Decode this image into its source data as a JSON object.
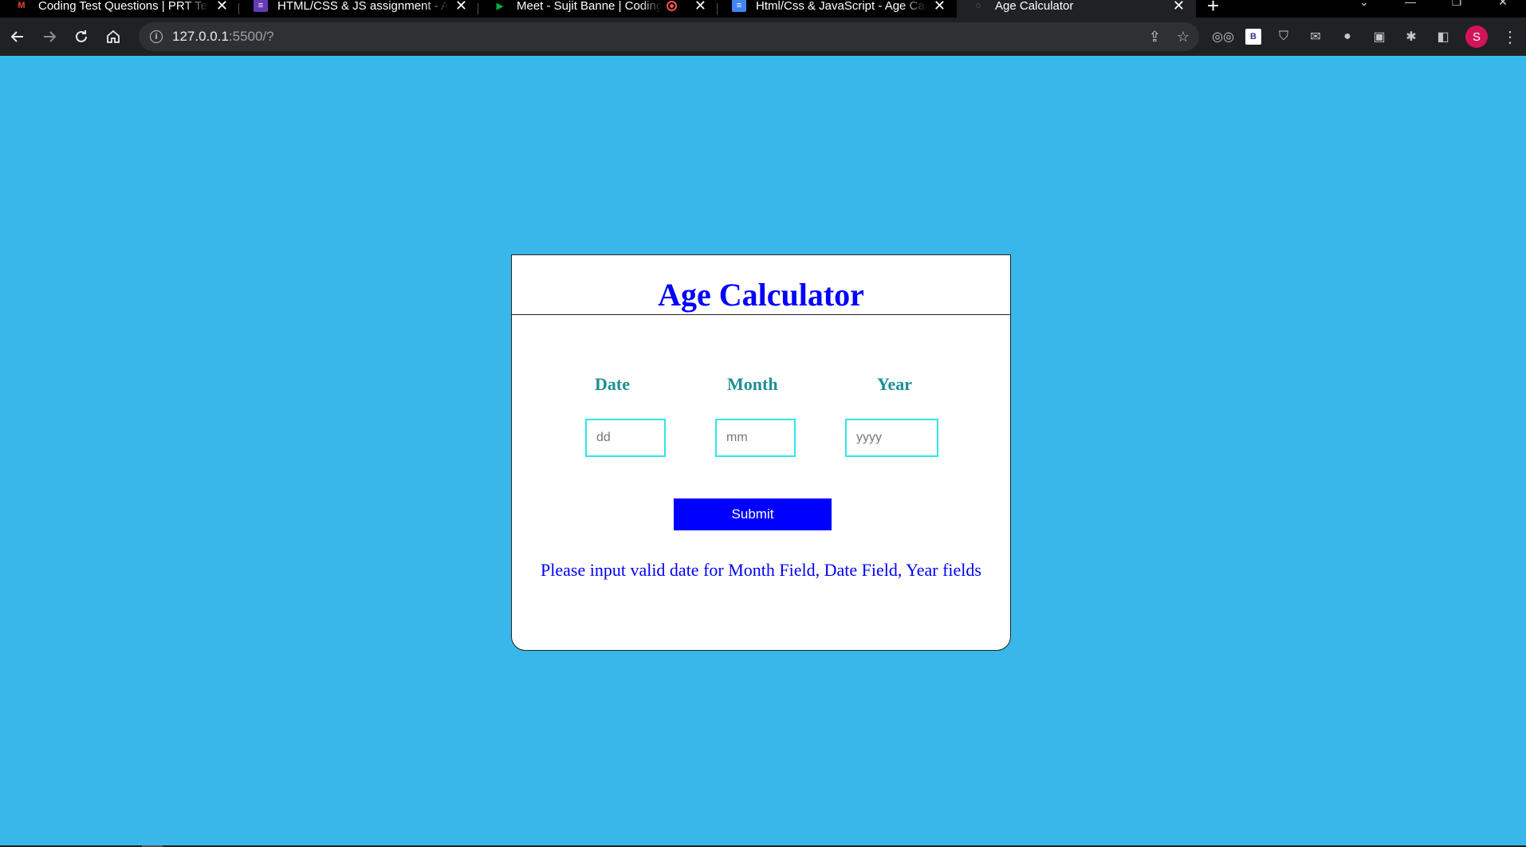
{
  "browser": {
    "tabs": [
      {
        "title": "Coding Test Questions | PRT Test",
        "favicon": "M",
        "favicon_color": "#ea4335"
      },
      {
        "title": "HTML/CSS & JS assignment - Age Calculator",
        "favicon": "≡",
        "favicon_color": "#673ab7"
      },
      {
        "title": "Meet - Sujit Banne | Coding",
        "favicon": "▶",
        "favicon_color": "#00ac47"
      },
      {
        "title": "Html/Css & JavaScript - Age Calculator",
        "favicon": "≡",
        "favicon_color": "#4285f4"
      },
      {
        "title": "Age Calculator",
        "favicon": "◌",
        "favicon_color": "#9aa0a6"
      }
    ],
    "close_glyph": "✕",
    "new_tab_glyph": "+",
    "url_host": "127.0.0.1",
    "url_path": ":5500/?",
    "avatar_letter": "S"
  },
  "page": {
    "title": "Age Calculator",
    "fields": {
      "date": {
        "label": "Date",
        "placeholder": "dd"
      },
      "month": {
        "label": "Month",
        "placeholder": "mm"
      },
      "year": {
        "label": "Year",
        "placeholder": "yyyy"
      }
    },
    "submit_label": "Submit",
    "message": "Please input valid date for Month Field, Date Field, Year fields"
  },
  "colors": {
    "background": "#38b8ea",
    "title": "#0000ff",
    "label": "#1e8f93",
    "input_border": "#2ee8e8",
    "button": "#0000ff"
  }
}
